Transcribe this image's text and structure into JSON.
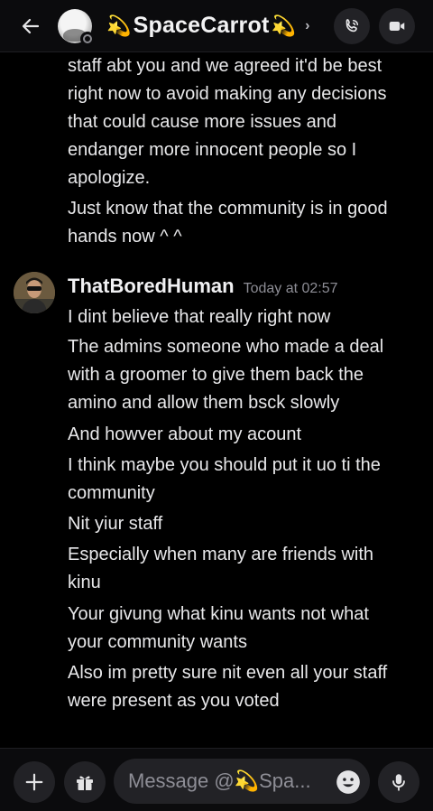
{
  "header": {
    "channel_name": "SpaceCarrot",
    "spark_left": "💫",
    "spark_right": "💫",
    "icons": {
      "back": "arrow-left-icon",
      "call": "phone-icon",
      "video": "video-camera-icon",
      "chevron": "chevron-right-icon"
    }
  },
  "messages": {
    "continued_lines": [
      "staff abt you and we agreed it'd be best",
      "right now to avoid making any decisions",
      "that could cause more issues and",
      "endanger more innocent people so I",
      "apologize.",
      "Just know that the community is in good",
      "hands now ^ ^"
    ],
    "second": {
      "author": "ThatBoredHuman",
      "timestamp": "Today at 02:57",
      "lines": [
        "I dint believe that really right now",
        "The admins someone who made a deal",
        "with a groomer to give them back the",
        "amino and allow them bsck slowly",
        "And howver about my acount",
        "I think maybe you should put it uo ti the",
        "community",
        "Nit yiur staff",
        "Especially when many are friends with",
        "kinu",
        "Your givung what kinu wants not what",
        "your community wants",
        "Also im pretty sure nit even all your staff",
        "were present as you voted"
      ]
    }
  },
  "composer": {
    "placeholder": "Message @💫Spa...",
    "icons": {
      "add": "plus-icon",
      "gift": "gift-icon",
      "emoji": "emoji-icon",
      "mic": "microphone-icon"
    }
  },
  "colors": {
    "background": "#000000",
    "bar": "#0b0b0d",
    "button": "#222226",
    "text": "#e8e8ea",
    "muted": "#8d8d95"
  }
}
